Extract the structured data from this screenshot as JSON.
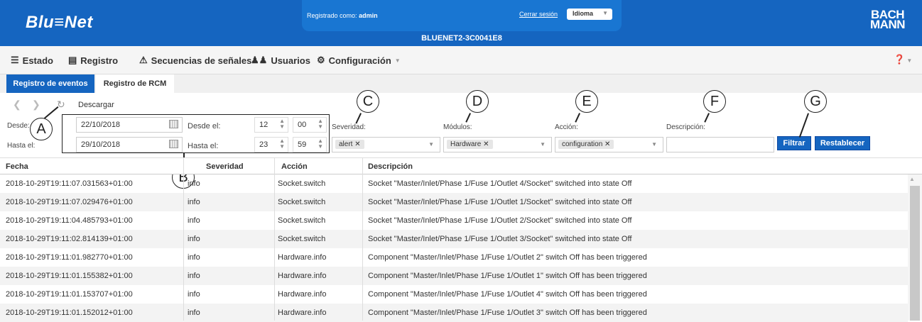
{
  "header": {
    "logo": "Blu≡Net",
    "login_prefix": "Registrado como:",
    "login_user": "admin",
    "logout": "Cerrar sesión",
    "language": "Idioma",
    "device": "BLUENET2-3C0041E8",
    "brand_line1": "BACH",
    "brand_line2": "MANN",
    "colors": {
      "primary": "#1565c0",
      "panel": "#1976d2"
    }
  },
  "nav": {
    "items": [
      {
        "label": "Estado",
        "icon": "menu-lines-icon"
      },
      {
        "label": "Registro",
        "icon": "document-icon"
      },
      {
        "label": "Secuencias de señales",
        "icon": "warning-triangle-icon"
      },
      {
        "label": "Usuarios",
        "icon": "users-icon"
      },
      {
        "label": "Configuración",
        "icon": "gear-icon"
      }
    ],
    "help_icon": "question-circle-icon"
  },
  "subtabs": [
    "Registro de eventos",
    "Registro de RCM"
  ],
  "toolbar": {
    "download": "Descargar"
  },
  "filters": {
    "from_label": "Desde:",
    "to_label": "Hasta el:",
    "from_date": "22/10/2018",
    "to_date": "29/10/2018",
    "from_time_label": "Desde el:",
    "to_time_label": "Hasta el:",
    "from_hour": "12",
    "from_min": "00",
    "to_hour": "23",
    "to_min": "59",
    "severity_label": "Severidad:",
    "severity_tag": "alert",
    "modules_label": "Módulos:",
    "modules_tag": "Hardware",
    "action_label": "Acción:",
    "action_tag": "configuration",
    "description_label": "Descripción:",
    "description_value": "",
    "filter_button": "Filtrar",
    "reset_button": "Restablecer"
  },
  "callouts": [
    "A",
    "B",
    "C",
    "D",
    "E",
    "F",
    "G"
  ],
  "table": {
    "columns": [
      "Fecha",
      "Severidad",
      "Acción",
      "Descripción"
    ],
    "rows": [
      [
        "2018-10-29T19:11:07.031563+01:00",
        "info",
        "Socket.switch",
        "Socket \"Master/Inlet/Phase 1/Fuse 1/Outlet 4/Socket\" switched into state Off"
      ],
      [
        "2018-10-29T19:11:07.029476+01:00",
        "info",
        "Socket.switch",
        "Socket \"Master/Inlet/Phase 1/Fuse 1/Outlet 1/Socket\" switched into state Off"
      ],
      [
        "2018-10-29T19:11:04.485793+01:00",
        "info",
        "Socket.switch",
        "Socket \"Master/Inlet/Phase 1/Fuse 1/Outlet 2/Socket\" switched into state Off"
      ],
      [
        "2018-10-29T19:11:02.814139+01:00",
        "info",
        "Socket.switch",
        "Socket \"Master/Inlet/Phase 1/Fuse 1/Outlet 3/Socket\" switched into state Off"
      ],
      [
        "2018-10-29T19:11:01.982770+01:00",
        "info",
        "Hardware.info",
        "Component \"Master/Inlet/Phase 1/Fuse 1/Outlet 2\" switch Off has been triggered"
      ],
      [
        "2018-10-29T19:11:01.155382+01:00",
        "info",
        "Hardware.info",
        "Component \"Master/Inlet/Phase 1/Fuse 1/Outlet 1\" switch Off has been triggered"
      ],
      [
        "2018-10-29T19:11:01.153707+01:00",
        "info",
        "Hardware.info",
        "Component \"Master/Inlet/Phase 1/Fuse 1/Outlet 4\" switch Off has been triggered"
      ],
      [
        "2018-10-29T19:11:01.152012+01:00",
        "info",
        "Hardware.info",
        "Component \"Master/Inlet/Phase 1/Fuse 1/Outlet 3\" switch Off has been triggered"
      ]
    ]
  }
}
